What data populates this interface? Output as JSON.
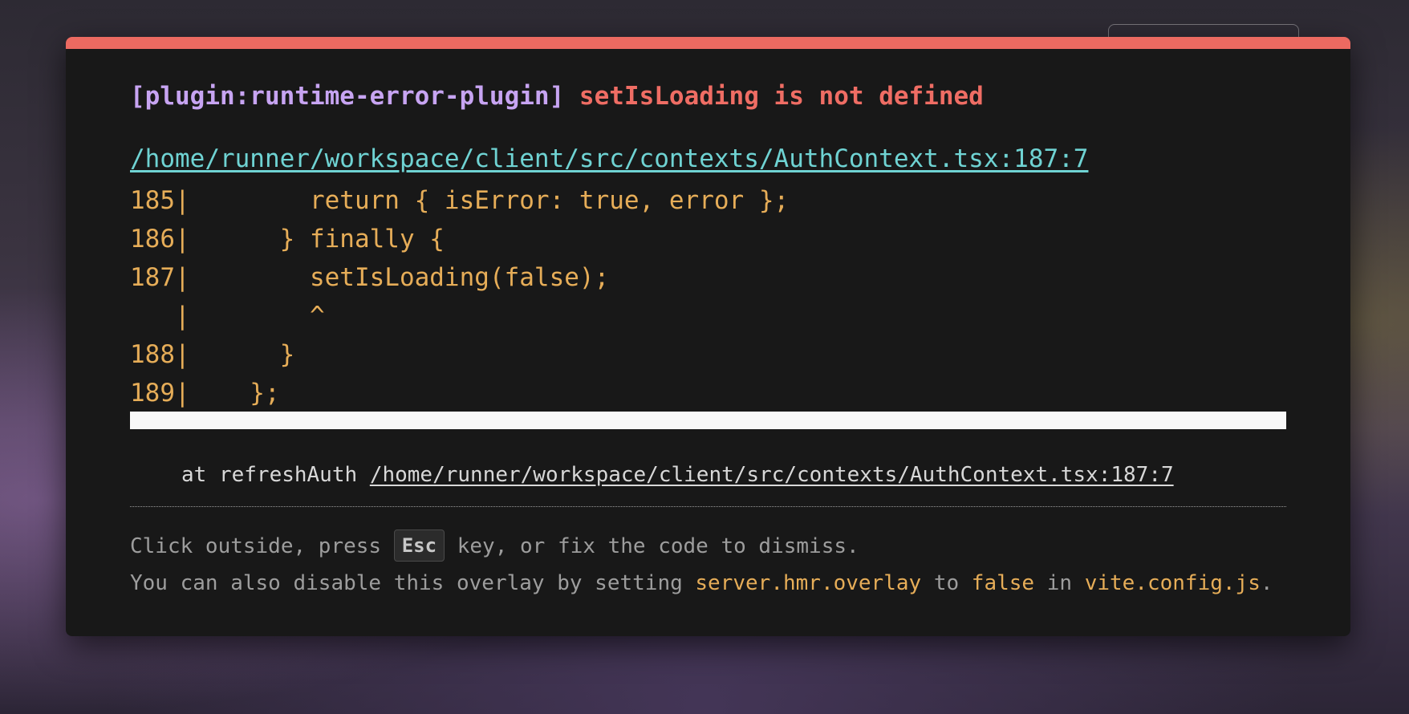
{
  "error": {
    "plugin": "[plugin:runtime-error-plugin]",
    "message": "setIsLoading is not defined",
    "file": "/home/runner/workspace/client/src/contexts/AuthContext.tsx:187:7"
  },
  "code_frame": [
    "185|        return { isError: true, error };",
    "186|      } finally {",
    "187|        setIsLoading(false);",
    "   |        ^",
    "188|      }",
    "189|    };"
  ],
  "stack": {
    "prefix": "at refreshAuth ",
    "file": "/home/runner/workspace/client/src/contexts/AuthContext.tsx:187:7"
  },
  "tip": {
    "line1_before": "Click outside, press ",
    "esc_key": "Esc",
    "line1_after": " key, or fix the code to dismiss.",
    "line2_before": "You can also disable this overlay by setting ",
    "setting_name": "server.hmr.overlay",
    "line2_mid1": " to ",
    "false_value": "false",
    "line2_mid2": " in ",
    "config_file": "vite.config.js",
    "line2_end": "."
  },
  "colors": {
    "accent_bar": "#ec6a61",
    "plugin": "#c7a4f2",
    "error": "#ef6d64",
    "file_link": "#6fd3d3",
    "code": "#e6ad58"
  }
}
